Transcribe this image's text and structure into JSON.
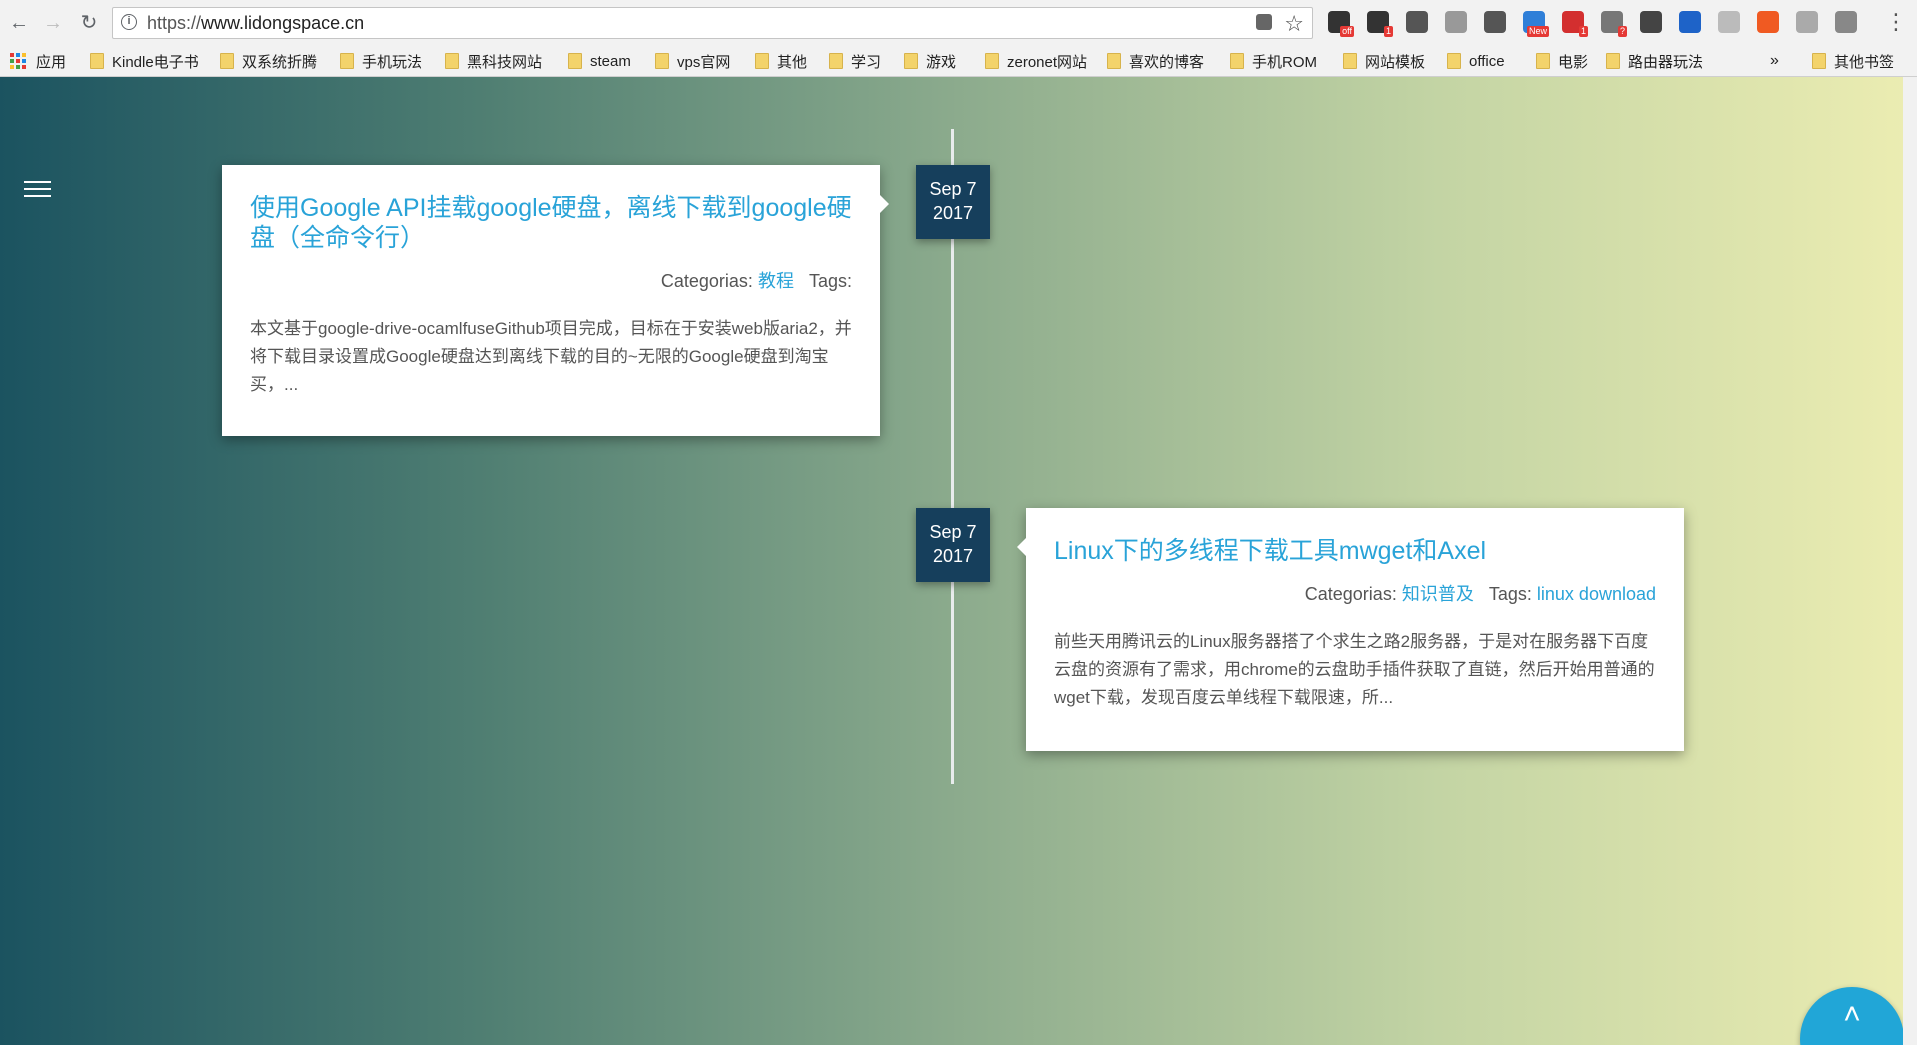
{
  "browser": {
    "url_protocol": "https://",
    "url_host": "www.lidongspace.cn",
    "extensions": [
      {
        "name": "ext-off",
        "color": "#333",
        "badge": "off"
      },
      {
        "name": "ext-1",
        "color": "#333",
        "badge": "1"
      },
      {
        "name": "ext-bulb",
        "color": "#555",
        "badge": ""
      },
      {
        "name": "ext-mail",
        "color": "#999",
        "badge": ""
      },
      {
        "name": "ext-lamp",
        "color": "#555",
        "badge": ""
      },
      {
        "name": "ext-new",
        "color": "#2f7fd8",
        "badge": "New"
      },
      {
        "name": "ext-abp",
        "color": "#d32f2f",
        "badge": "1"
      },
      {
        "name": "ext-gmail",
        "color": "#777",
        "badge": "?"
      },
      {
        "name": "ext-evernote",
        "color": "#444",
        "badge": ""
      },
      {
        "name": "ext-shield",
        "color": "#1e63c8",
        "badge": ""
      },
      {
        "name": "ext-drive",
        "color": "#bbb",
        "badge": ""
      },
      {
        "name": "ext-x",
        "color": "#f05a22",
        "badge": ""
      },
      {
        "name": "ext-reader",
        "color": "#aaa",
        "badge": ""
      },
      {
        "name": "ext-wp",
        "color": "#888",
        "badge": ""
      }
    ]
  },
  "bookmarks": {
    "apps_label": "应用",
    "items": [
      "Kindle电子书",
      "双系统折腾",
      "手机玩法",
      "黑科技网站",
      "steam",
      "vps官网",
      "其他",
      "学习",
      "游戏",
      "zeronet网站",
      "喜欢的博客",
      "手机ROM",
      "网站模板",
      "office",
      "电影",
      "路由器玩法"
    ],
    "overflow": "»",
    "other_label": "其他书签"
  },
  "posts": [
    {
      "date_month": "Sep 7",
      "date_year": "2017",
      "title": "使用Google API挂载google硬盘，离线下载到google硬盘（全命令行）",
      "categories_label": "Categorias:",
      "category": "教程",
      "tags_label": "Tags:",
      "tags": "",
      "excerpt": "本文基于google-drive-ocamlfuseGithub项目完成，目标在于安装web版aria2，并将下载目录设置成Google硬盘达到离线下载的目的~无限的Google硬盘到淘宝买，..."
    },
    {
      "date_month": "Sep 7",
      "date_year": "2017",
      "title": "Linux下的多线程下载工具mwget和Axel",
      "categories_label": "Categorias:",
      "category": "知识普及",
      "tags_label": "Tags:",
      "tags": "linux download",
      "excerpt": "前些天用腾讯云的Linux服务器搭了个求生之路2服务器，于是对在服务器下百度云盘的资源有了需求，用chrome的云盘助手插件获取了直链，然后开始用普通的wget下载，发现百度云单线程下载限速，所..."
    }
  ],
  "fab": {
    "icon": "chevron-up-icon",
    "glyph": "˄"
  }
}
